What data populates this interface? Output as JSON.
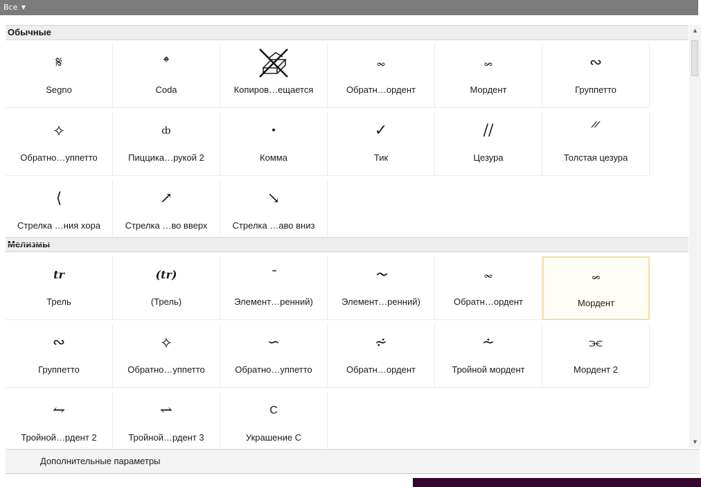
{
  "filter": {
    "label": "Все",
    "caret": "▼"
  },
  "sections": [
    {
      "title": "Обычные",
      "items": [
        {
          "label": "Segno",
          "symbol": "𝄋",
          "icon": "segno-icon"
        },
        {
          "label": "Coda",
          "symbol": "𝄌",
          "icon": "coda-icon"
        },
        {
          "label": "Копиров…ещается",
          "symbol": "",
          "icon": "copy-not-allowed-icon"
        },
        {
          "label": "Обратн…ордент",
          "symbol": "𝆗",
          "icon": "inverted-mordent-icon"
        },
        {
          "label": "Мордент",
          "symbol": "𝆘",
          "icon": "mordent-icon"
        },
        {
          "label": "Группетто",
          "symbol": "∾",
          "icon": "turn-icon"
        },
        {
          "label": "Обратно…уппетто",
          "symbol": "⟡",
          "icon": "inverted-turn-icon"
        },
        {
          "label": "Пиццика…рукой 2",
          "symbol": "ȸ",
          "icon": "pizzicato-icon"
        },
        {
          "label": "Комма",
          "symbol": "•",
          "icon": "comma-icon"
        },
        {
          "label": "Тик",
          "symbol": "✓",
          "icon": "tick-icon"
        },
        {
          "label": "Цезура",
          "symbol": "//",
          "icon": "caesura-icon"
        },
        {
          "label": "Толстая цезура",
          "symbol": "𝄓",
          "icon": "thick-caesura-icon"
        },
        {
          "label": "Стрелка …ния хора",
          "symbol": "⟨",
          "icon": "choir-arrow-icon"
        },
        {
          "label": "Стрелка …во вверх",
          "symbol": "↗",
          "icon": "arrow-up-right-icon"
        },
        {
          "label": "Стрелка …аво вниз",
          "symbol": "↘",
          "icon": "arrow-down-right-icon"
        }
      ]
    },
    {
      "title": "Мелизмы",
      "items": [
        {
          "label": "Трель",
          "symbol": "tr",
          "icon": "trill-icon"
        },
        {
          "label": "(Трель)",
          "symbol": "(tr)",
          "icon": "trill-parenthesized-icon"
        },
        {
          "label": "Элемент…ренний)",
          "symbol": "˜",
          "icon": "trill-element-icon"
        },
        {
          "label": "Элемент…ренний)",
          "symbol": "〜",
          "icon": "trill-element-2-icon"
        },
        {
          "label": "Обратн…ордент",
          "symbol": "𝆗",
          "icon": "inverted-mordent-icon"
        },
        {
          "label": "Мордент",
          "symbol": "𝆘",
          "icon": "mordent-icon",
          "selected": true
        },
        {
          "label": "Группетто",
          "symbol": "∾",
          "icon": "turn-icon"
        },
        {
          "label": "Обратно…уппетто",
          "symbol": "⟡",
          "icon": "inverted-turn-icon"
        },
        {
          "label": "Обратно…уппетто",
          "symbol": "∽",
          "icon": "inverted-turn-2-icon"
        },
        {
          "label": "Обратн…ордент",
          "symbol": "⩫",
          "icon": "long-inverted-mordent-icon"
        },
        {
          "label": "Тройной мордент",
          "symbol": "⩪",
          "icon": "triple-mordent-icon"
        },
        {
          "label": "Мордент 2",
          "symbol": "⫘",
          "icon": "mordent-2-icon"
        },
        {
          "label": "Тройной…рдент 2",
          "symbol": "⥊",
          "icon": "triple-mordent-2-icon"
        },
        {
          "label": "Тройной…рдент 3",
          "symbol": "⥋",
          "icon": "triple-mordent-3-icon"
        },
        {
          "label": "Украшение C",
          "symbol": "C",
          "icon": "ornament-c-icon"
        }
      ]
    }
  ],
  "footer": {
    "more_options": "Дополнительные параметры"
  },
  "scrollbar": {
    "up_arrow": "▲",
    "down_arrow": "▼"
  },
  "colors": {
    "topbar": "#7b7b7b",
    "section_header": "#eeeeee",
    "selected_border": "#f1e3a2",
    "bottom_strip": "#34062f"
  }
}
